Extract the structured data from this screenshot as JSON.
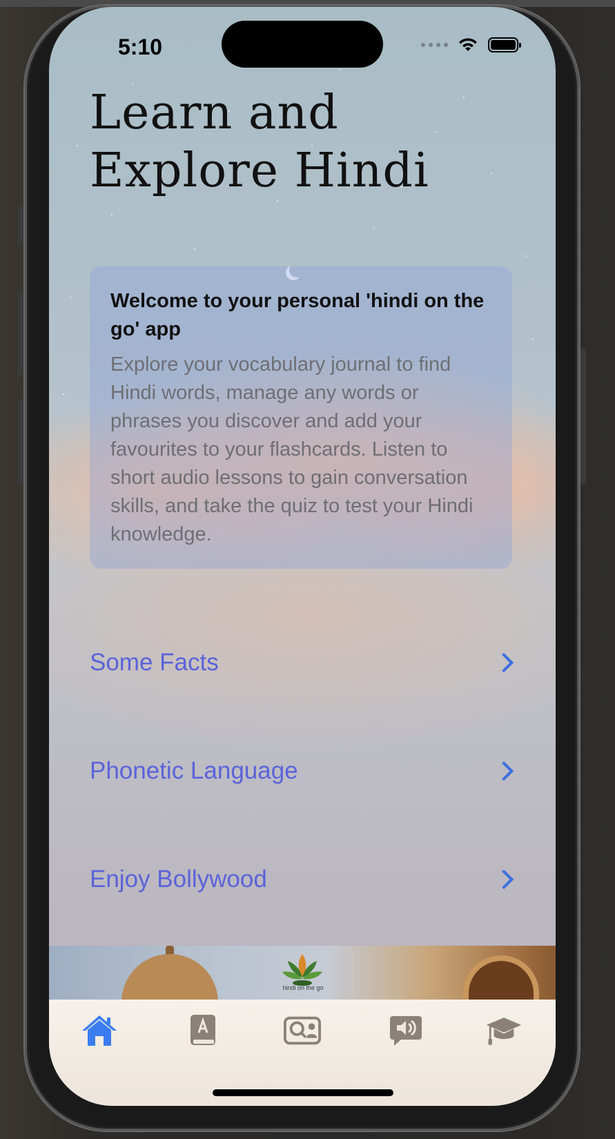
{
  "status_bar": {
    "time": "5:10"
  },
  "header": {
    "title_line1": "Learn and",
    "title_line2": "Explore Hindi"
  },
  "welcome": {
    "title": "Welcome to your personal 'hindi on the go' app",
    "body": "Explore your vocabulary journal to find Hindi words, manage any words or phrases you discover and add your favourites to your flashcards. Listen to short audio lessons to gain conversation skills, and take the quiz to test your Hindi knowledge."
  },
  "nav_items": [
    {
      "label": "Some Facts"
    },
    {
      "label": "Phonetic Language"
    },
    {
      "label": "Enjoy Bollywood"
    }
  ],
  "banner": {
    "logo_text": "hindi on the go"
  },
  "tabs": [
    {
      "icon": "house-icon",
      "active": true
    },
    {
      "icon": "dictionary-book-icon",
      "active": false
    },
    {
      "icon": "flashcards-search-icon",
      "active": false
    },
    {
      "icon": "audio-speech-icon",
      "active": false
    },
    {
      "icon": "graduation-cap-icon",
      "active": false
    }
  ],
  "colors": {
    "accent": "#3b7df0",
    "inactive_tab": "#8c8178",
    "link": "#5a63d9"
  }
}
